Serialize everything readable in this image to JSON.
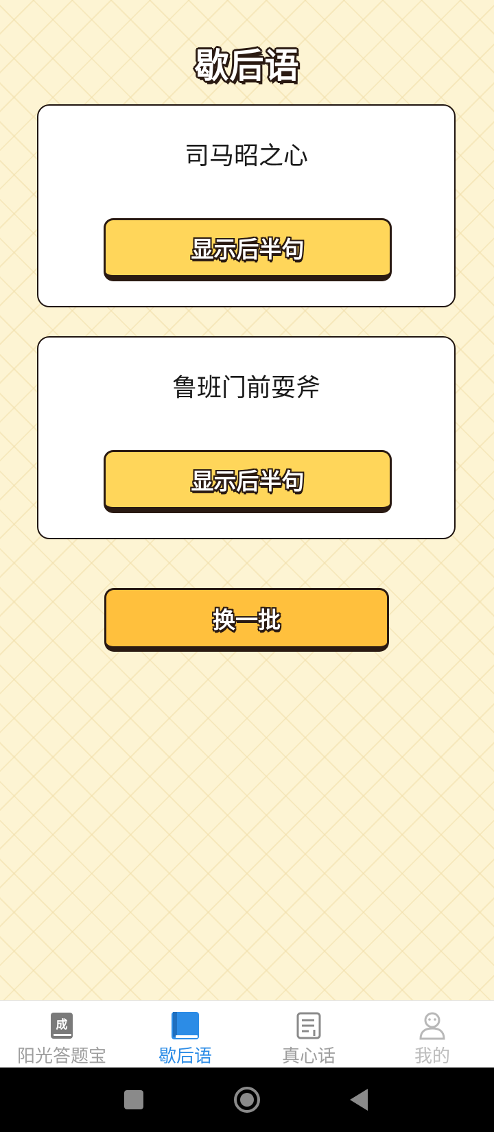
{
  "header": {
    "title": "歇后语"
  },
  "cards": [
    {
      "question": "司马昭之心",
      "reveal_label": "显示后半句"
    },
    {
      "question": "鲁班门前耍斧",
      "reveal_label": "显示后半句"
    }
  ],
  "actions": {
    "refresh_label": "换一批"
  },
  "tabbar": {
    "items": [
      {
        "label": "阳光答题宝",
        "icon": "idiom-book-icon",
        "icon_text": "成",
        "active": false
      },
      {
        "label": "歇后语",
        "icon": "book-icon",
        "active": true
      },
      {
        "label": "真心话",
        "icon": "document-icon",
        "active": false
      },
      {
        "label": "我的",
        "icon": "user-icon",
        "active": false
      }
    ]
  },
  "system_nav": {
    "buttons": [
      "recents-icon",
      "home-icon",
      "back-icon"
    ]
  },
  "colors": {
    "background": "#fdf4d3",
    "reveal_button": "#ffd65a",
    "refresh_button": "#ffc03d",
    "outline": "#2a1a12",
    "tab_active": "#2c8ce6",
    "tab_inactive": "#9e9e9e"
  }
}
